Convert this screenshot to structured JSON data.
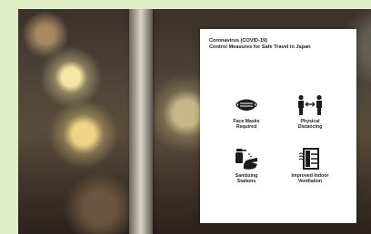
{
  "sign": {
    "title": "Coronavirus (COVID-19)\nControl Measures for Safe Travel in Japan",
    "measures": [
      {
        "icon": "face-mask-icon",
        "label": "Face Masks\nRequired"
      },
      {
        "icon": "physical-distancing-icon",
        "label": "Physical\nDistancing"
      },
      {
        "icon": "sanitizer-icon",
        "label": "Sanitizing\nStations"
      },
      {
        "icon": "ventilation-icon",
        "label": "Improved Indoor\nVentilation"
      }
    ]
  },
  "colors": {
    "background": "#dff0c8",
    "sign": "#ffffff",
    "icon": "#1b1b1b"
  }
}
